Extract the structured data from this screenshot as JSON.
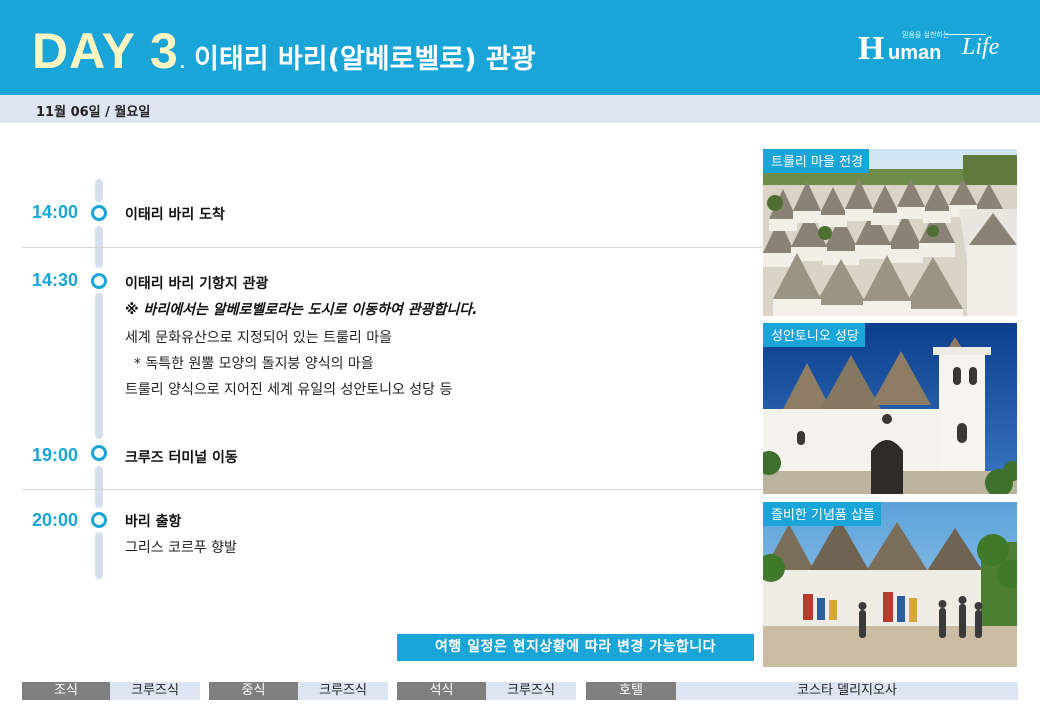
{
  "header": {
    "day_word": "DAY  3",
    "day_dot": ".",
    "title": "이태리 바리(알베로벨로) 관광"
  },
  "logo": {
    "tagline": "믿음을 실천하는",
    "h": "H",
    "uman": "uman",
    "life": "Life"
  },
  "date": "11월 06일 / 월요일",
  "schedule": [
    {
      "time": "14:00",
      "title": "이태리 바리 도착",
      "lines": []
    },
    {
      "time": "14:30",
      "title": "이태리 바리 기항지 관광",
      "note": "※ 바리에서는 알베로벨로라는 도시로 이동하여 관광합니다.",
      "lines": [
        "세계 문화유산으로 지정되어 있는 트룰리 마을",
        "  * 독특한 원뿔 모양의 돌지붕 양식의 마을",
        "트룰리 양식으로 지어진 세계 유일의 성안토니오 성당 등"
      ]
    },
    {
      "time": "19:00",
      "title": "크루즈 터미널 이동",
      "lines": []
    },
    {
      "time": "20:00",
      "title": "바리 출항",
      "lines": [
        "그리스 코르푸 향발"
      ]
    }
  ],
  "photos": [
    {
      "label": "트룰리 마을 전경"
    },
    {
      "label": "성안토니오 성당"
    },
    {
      "label": "즐비한 기념품 샵들"
    }
  ],
  "notice": "여행 일정은 현지상황에 따라 변경 가능합니다",
  "meals": [
    {
      "label": "조식",
      "value": "크루즈식"
    },
    {
      "label": "중식",
      "value": "크루즈식"
    },
    {
      "label": "석식",
      "value": "크루즈식"
    },
    {
      "label": "호텔",
      "value": "코스타 델리지오사"
    }
  ],
  "colors": {
    "accent": "#1aa5d8",
    "day_word": "#fdf6c3",
    "date_bar": "#dce5f1",
    "meal_label": "#7f7f7f"
  }
}
